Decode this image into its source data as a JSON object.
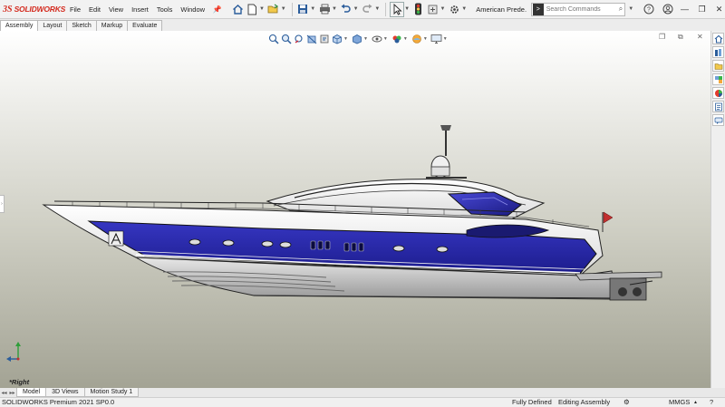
{
  "app": {
    "logo_prefix": "3S",
    "logo_name": "SOLIDWORKS",
    "document_title": "American Prede...",
    "colors": {
      "brand_red": "#d42a1e",
      "hull_blue": "#2626a8",
      "hull_white": "#f4f4f4"
    }
  },
  "menu": [
    {
      "label": "File"
    },
    {
      "label": "Edit"
    },
    {
      "label": "View"
    },
    {
      "label": "Insert"
    },
    {
      "label": "Tools"
    },
    {
      "label": "Window"
    }
  ],
  "toolbar": {
    "icons": [
      "home-icon",
      "new-document-icon",
      "open-icon",
      "save-icon",
      "print-icon",
      "undo-icon",
      "redo-icon",
      "select-icon",
      "traffic-light-icon",
      "rebuild-icon",
      "options-icon"
    ]
  },
  "search": {
    "placeholder": "Search Commands",
    "prompt_symbol": ">"
  },
  "tabs": [
    {
      "label": "Assembly"
    },
    {
      "label": "Layout"
    },
    {
      "label": "Sketch"
    },
    {
      "label": "Markup"
    },
    {
      "label": "Evaluate"
    }
  ],
  "viewport": {
    "view_label": "*Right",
    "heads_up_icons": [
      "zoom-to-fit-icon",
      "zoom-area-icon",
      "previous-view-icon",
      "section-view-icon",
      "dynamic-annotation-icon",
      "view-orientation-icon",
      "display-style-icon",
      "hide-show-icon",
      "edit-appearance-icon",
      "apply-scene-icon",
      "view-settings-icon"
    ]
  },
  "model_tabs": [
    {
      "label": "Model"
    },
    {
      "label": "3D Views"
    },
    {
      "label": "Motion Study 1"
    }
  ],
  "status": {
    "version": "SOLIDWORKS Premium 2021 SP0.0",
    "state": "Fully Defined",
    "mode": "Editing Assembly",
    "units": "MMGS"
  }
}
